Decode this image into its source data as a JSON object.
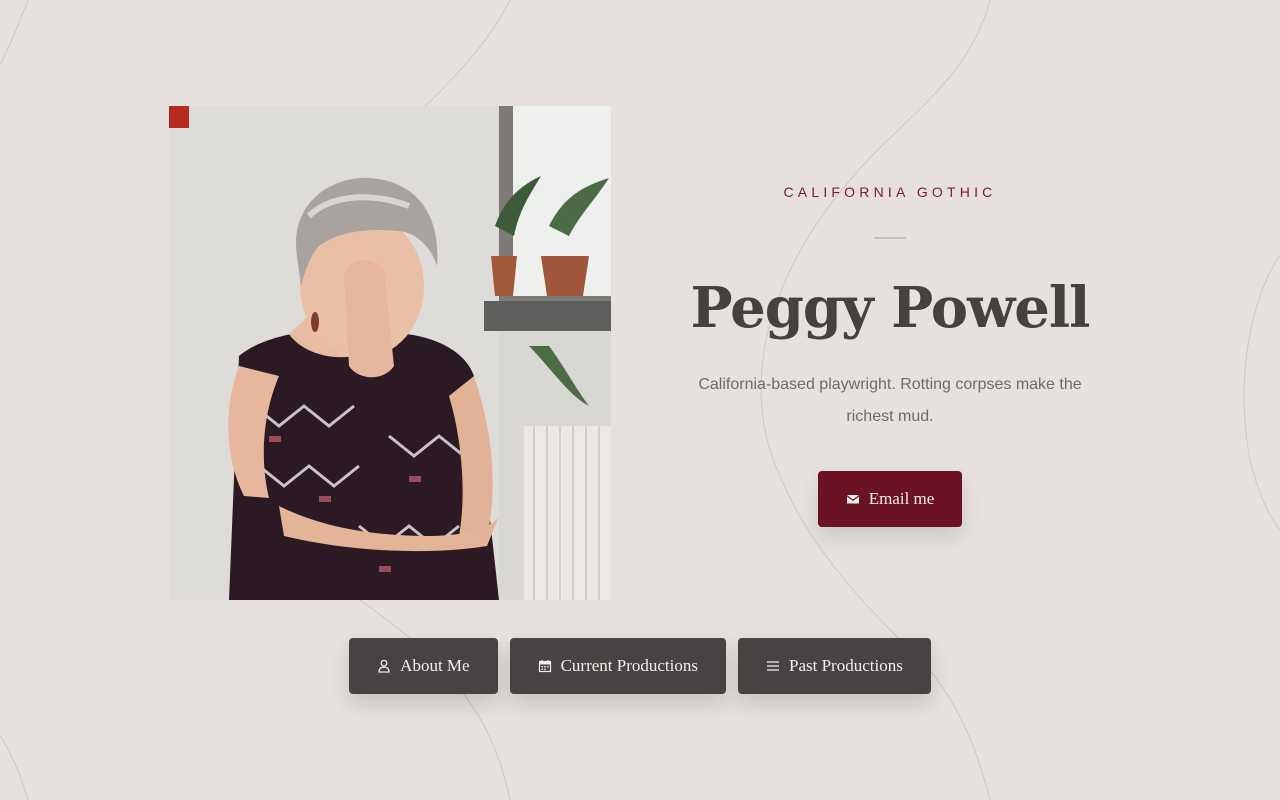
{
  "hero": {
    "eyebrow": "CALIFORNIA GOTHIC",
    "name": "Peggy Powell",
    "bio": "California-based playwright. Rotting corpses make the richest mud.",
    "email_label": "Email me",
    "email_icon": "envelope-icon"
  },
  "nav": {
    "items": [
      {
        "label": "About Me",
        "icon": "user-icon"
      },
      {
        "label": "Current Productions",
        "icon": "calendar-icon"
      },
      {
        "label": "Past Productions",
        "icon": "list-icon"
      }
    ]
  },
  "colors": {
    "background": "#e6e1df",
    "accent": "#6b1323",
    "nav_button": "#464342",
    "heading": "#444141"
  }
}
